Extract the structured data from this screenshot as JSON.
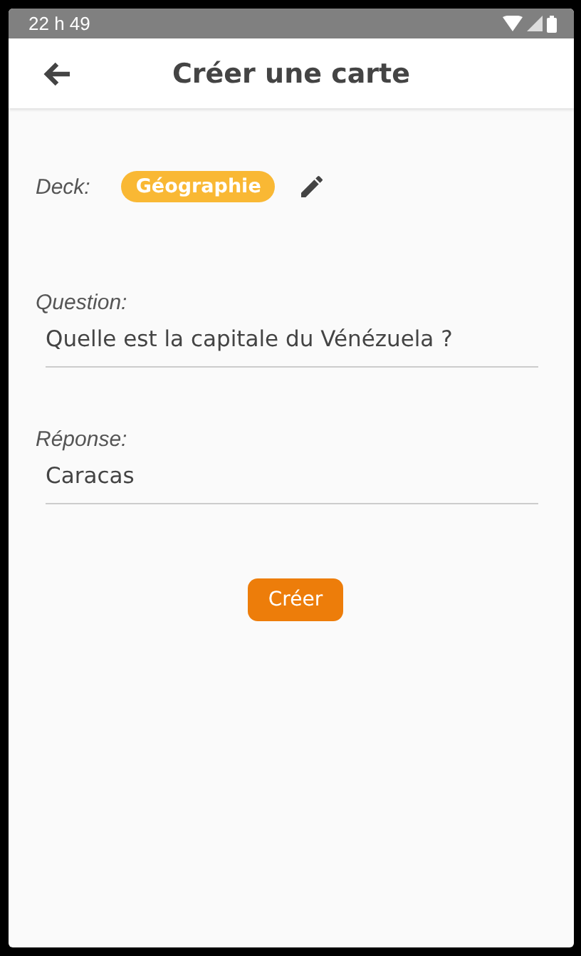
{
  "status_bar": {
    "time": "22 h 49"
  },
  "app_bar": {
    "title": "Créer une carte"
  },
  "deck": {
    "label": "Deck:",
    "name": "Géographie"
  },
  "fields": [
    {
      "label": "Question:",
      "value": "Quelle est la capitale du Vénézuela ?"
    },
    {
      "label": "Réponse:",
      "value": "Caracas"
    }
  ],
  "submit_button": "Créer"
}
